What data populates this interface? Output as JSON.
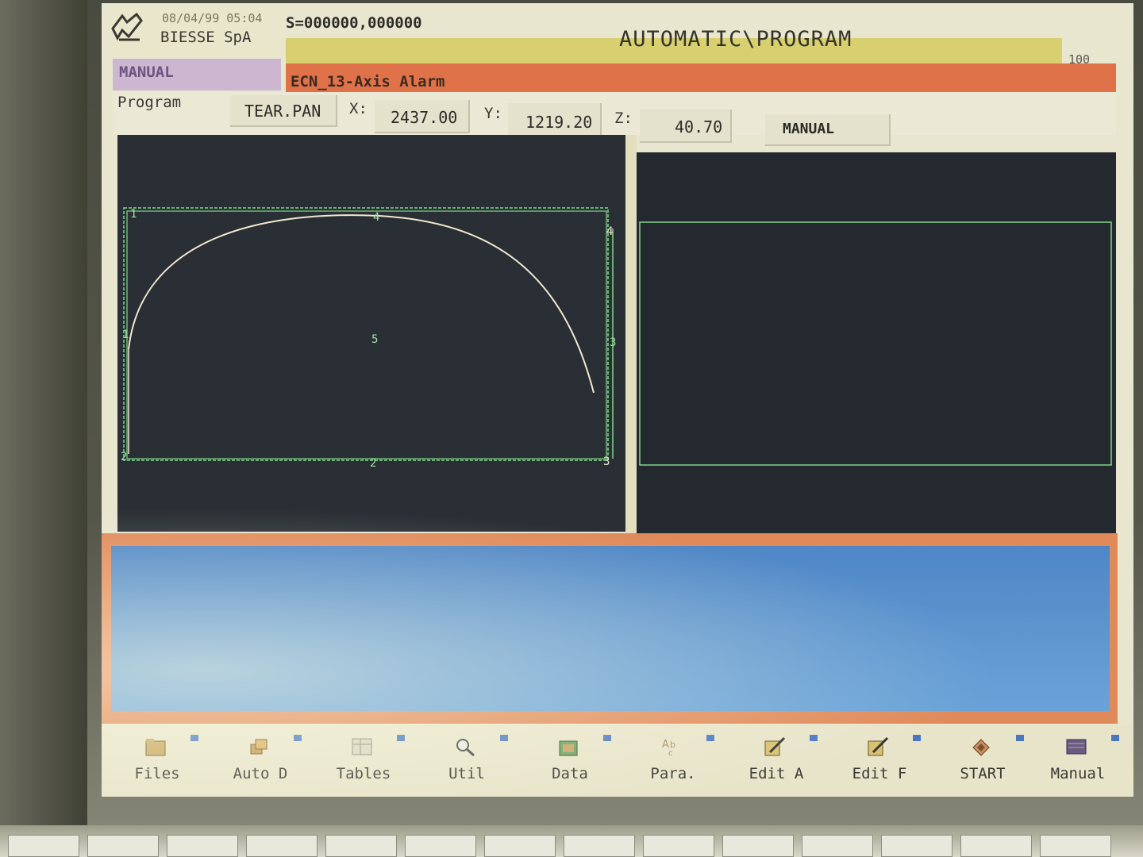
{
  "header": {
    "datetime": "08/04/99 05:04",
    "company": "BIESSE SpA",
    "s_coord": "S=000000,000000",
    "title": "AUTOMATIC\\PROGRAM",
    "counter": "100",
    "mode": "MANUAL",
    "alarm": "ECN_13-Axis Alarm"
  },
  "program": {
    "label": "Program",
    "name": "TEAR.PAN",
    "x_label": "X:",
    "x_value": "2437.00",
    "y_label": "Y:",
    "y_value": "1219.20",
    "z_label": "Z:",
    "z_value": "40.70",
    "mode_button": "MANUAL"
  },
  "drawing": {
    "corner_labels": [
      "1",
      "4",
      "4",
      "3",
      "3",
      "2",
      "2",
      "1"
    ],
    "center_label": "5",
    "colors": {
      "outline": "#7fd88a",
      "curve": "#f0ead0"
    }
  },
  "toolbar": {
    "items": [
      {
        "label": "Files",
        "icon": "folder-icon"
      },
      {
        "label": "Auto D",
        "icon": "auto-icon"
      },
      {
        "label": "Tables",
        "icon": "table-icon"
      },
      {
        "label": "Util",
        "icon": "magnifier-icon"
      },
      {
        "label": "Data",
        "icon": "data-icon"
      },
      {
        "label": "Para.",
        "icon": "text-icon"
      },
      {
        "label": "Edit A",
        "icon": "edit-icon"
      },
      {
        "label": "Edit F",
        "icon": "edit-icon"
      },
      {
        "label": "START",
        "icon": "start-icon"
      },
      {
        "label": "Manual",
        "icon": "manual-icon"
      }
    ]
  }
}
